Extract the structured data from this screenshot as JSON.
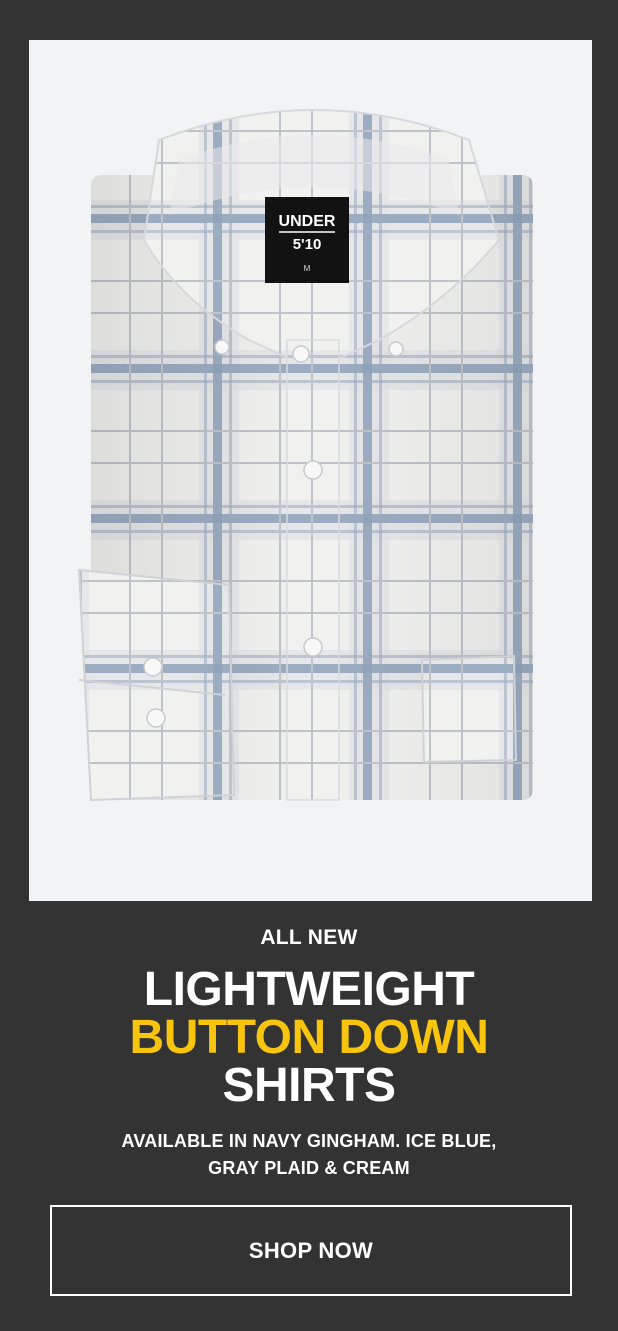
{
  "product_image": {
    "label_line1": "UNDER",
    "label_line2": "5'10",
    "label_size": "M"
  },
  "promo": {
    "eyebrow": "ALL NEW",
    "headline_line1": "LIGHTWEIGHT",
    "headline_line2": "BUTTON DOWN",
    "headline_line3": "SHIRTS",
    "subcopy_line1": "AVAILABLE IN NAVY GINGHAM. ICE BLUE,",
    "subcopy_line2": "GRAY PLAID & CREAM"
  },
  "cta": {
    "label": "SHOP NOW"
  },
  "colors": {
    "background": "#333333",
    "accent": "#f7c40e",
    "text": "#ffffff",
    "image_background": "#f2f3f4",
    "plaid_blue": "#8fa2bb",
    "plaid_gray": "#c9ccd0"
  }
}
